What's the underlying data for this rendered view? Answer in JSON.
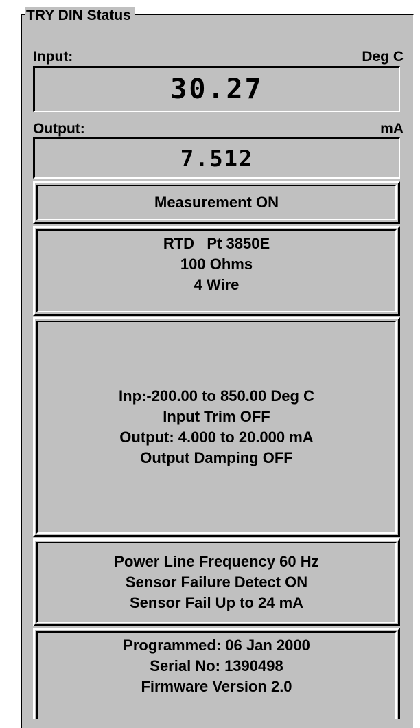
{
  "group_title": "TRY DIN Status",
  "input": {
    "label": "Input:",
    "unit": "Deg C",
    "value": "30.27"
  },
  "output": {
    "label": "Output:",
    "unit": "mA",
    "value": "7.512"
  },
  "measurement_status": "Measurement ON",
  "sensor": {
    "type": "RTD   Pt 3850E",
    "resistance": "100 Ohms",
    "wiring": "4 Wire"
  },
  "ranges": {
    "input_range": "Inp:-200.00 to 850.00 Deg C",
    "input_trim": "Input Trim OFF",
    "output_range": "Output: 4.000 to 20.000 mA",
    "output_damping": "Output Damping OFF"
  },
  "line_settings": {
    "power_line": "Power Line Frequency 60 Hz",
    "failure_detect": "Sensor Failure Detect ON",
    "fail_direction": "Sensor Fail Up to 24 mA"
  },
  "device_info": {
    "programmed": "Programmed: 06 Jan 2000",
    "serial": "Serial No: 1390498",
    "firmware": "Firmware Version 2.0"
  }
}
